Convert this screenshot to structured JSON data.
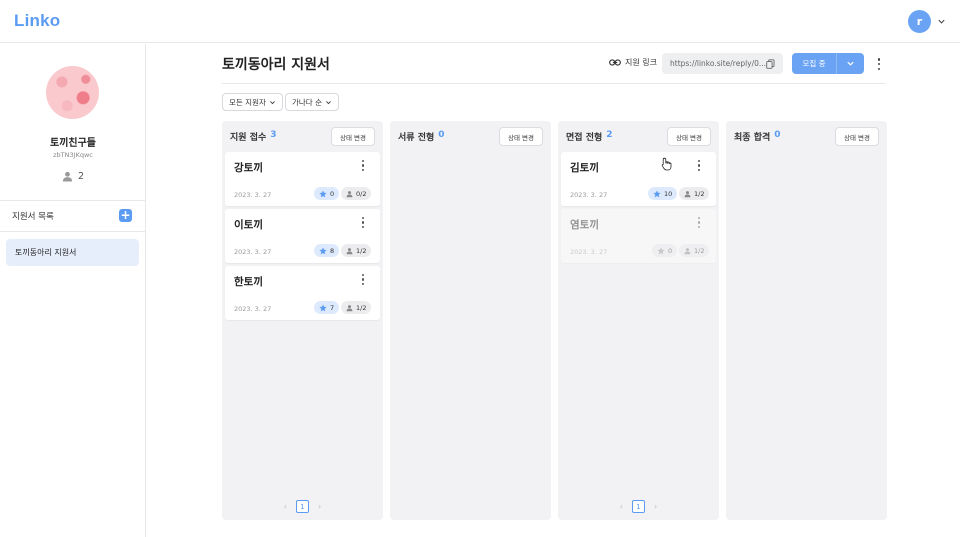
{
  "app": {
    "logo": "Linko",
    "user_initial": "r"
  },
  "sidebar": {
    "club_name": "토끼친구들",
    "club_code": "zbTN3JKqwc",
    "member_count": "2",
    "forms_title": "지원서 목록",
    "add_label": "+",
    "forms": [
      {
        "label": "토끼동아리 지원서"
      }
    ]
  },
  "header": {
    "title": "토끼동아리 지원서",
    "link_label": "지원 링크",
    "link_url": "https://linko.site/reply/0...",
    "recruit_label": "모집 중"
  },
  "filters": {
    "applicant_filter": "모든 지원자",
    "sort": "가나다 순"
  },
  "columns": [
    {
      "title": "지원 접수",
      "count": "3",
      "status_btn": "상태 변경",
      "page": "1",
      "cards": [
        {
          "name": "강토끼",
          "date": "2023. 3. 27",
          "stars": "0",
          "reviews": "0/2"
        },
        {
          "name": "이토끼",
          "date": "2023. 3. 27",
          "stars": "8",
          "reviews": "1/2"
        },
        {
          "name": "한토끼",
          "date": "2023. 3. 27",
          "stars": "7",
          "reviews": "1/2"
        }
      ]
    },
    {
      "title": "서류 전형",
      "count": "0",
      "status_btn": "상태 변경",
      "cards": []
    },
    {
      "title": "면접 전형",
      "count": "2",
      "status_btn": "상태 변경",
      "page": "1",
      "cards": [
        {
          "name": "김토끼",
          "date": "2023. 3. 27",
          "stars": "10",
          "reviews": "1/2"
        },
        {
          "name": "염토끼",
          "date": "2023. 3. 27",
          "stars": "0",
          "reviews": "1/2"
        }
      ]
    },
    {
      "title": "최종 합격",
      "count": "0",
      "status_btn": "상태 변경",
      "cards": []
    }
  ],
  "colors": {
    "accent": "#5b9cf2",
    "accent_light": "#e6eefc",
    "column_bg": "#f2f2f4"
  }
}
